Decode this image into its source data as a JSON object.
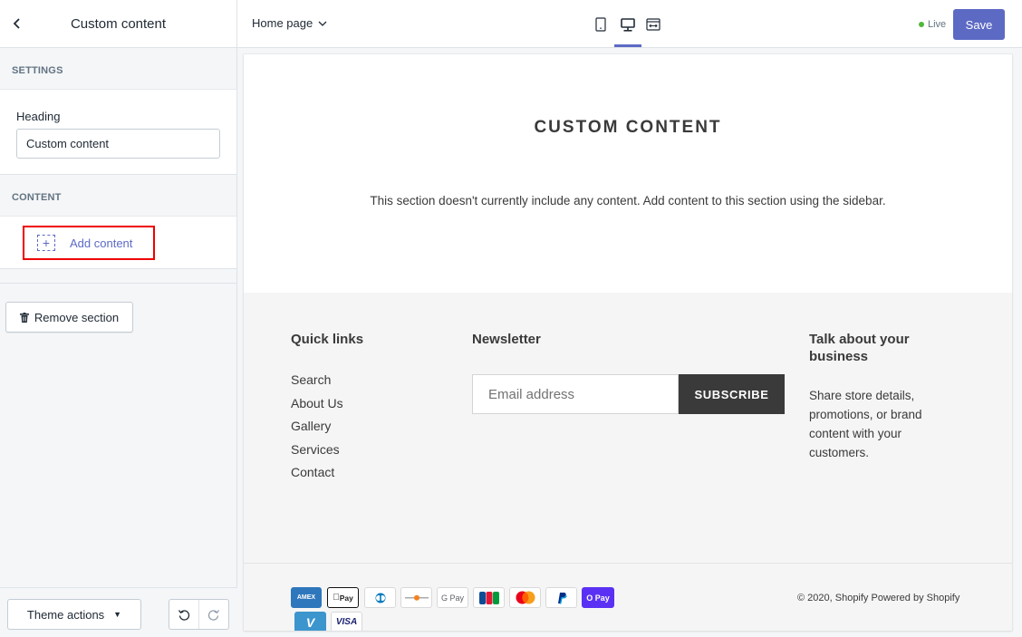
{
  "sidebar": {
    "title": "Custom content",
    "settings_label": "SETTINGS",
    "heading_label": "Heading",
    "heading_value": "Custom content",
    "content_label": "CONTENT",
    "add_content_label": "Add content",
    "remove_section_label": "Remove section",
    "theme_actions_label": "Theme actions"
  },
  "topbar": {
    "page_select": "Home page",
    "status": "Live",
    "save_label": "Save",
    "active_device": "desktop"
  },
  "preview": {
    "section_title": "CUSTOM CONTENT",
    "section_body": "This section doesn't currently include any content. Add content to this section using the sidebar.",
    "footer": {
      "quick_links_heading": "Quick links",
      "quick_links": [
        "Search",
        "About Us",
        "Gallery",
        "Services",
        "Contact"
      ],
      "newsletter_heading": "Newsletter",
      "email_placeholder": "Email address",
      "subscribe_label": "SUBSCRIBE",
      "business_heading": "Talk about your business",
      "business_text": "Share store details, promotions, or brand content with your customers.",
      "payment_icons": [
        "AMEX",
        "Pay",
        "Diners",
        "Discover",
        "G Pay",
        "JCB",
        "Mastercard",
        "PayPal",
        "O Pay",
        "Venmo",
        "VISA"
      ],
      "copyright": "© 2020, Shopify Powered by Shopify"
    }
  },
  "colors": {
    "accent": "#5c6ac4",
    "live_dot": "#50b83c",
    "highlight_border": "#ee0000",
    "subscribe_bg": "#3a3a3a"
  }
}
